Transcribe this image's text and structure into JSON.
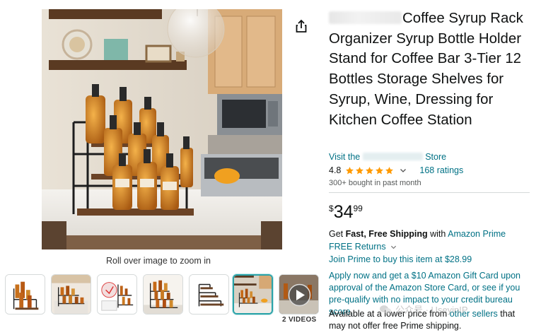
{
  "product": {
    "title_visible": "Coffee Syrup Rack Organizer Syrup Bottle Holder Stand for Coffee Bar 3-Tier 12 Bottles Storage Shelves for Syrup, Wine, Dressing for Kitchen Coffee Station",
    "store_link_prefix": "Visit the",
    "store_link_suffix": "Store"
  },
  "rating": {
    "value": "4.8",
    "stars": 4.8,
    "count_text": "168 ratings",
    "bought_text": "300+ bought in past month"
  },
  "price": {
    "symbol": "$",
    "whole": "34",
    "fraction": "99"
  },
  "shipping": {
    "prefix": "Get",
    "bold": "Fast, Free Shipping",
    "middle": "with",
    "prime_link": "Amazon Prime",
    "returns": "FREE Returns",
    "prime_buy": "Join Prime to buy this item at $28.99",
    "card_offer": "Apply now and get a $10 Amazon Gift Card upon approval of the Amazon Store Card, or see if you pre-qualify with no impact to your credit bureau score.",
    "availability_prefix": "Available at a lower price from",
    "availability_link": "other sellers",
    "availability_suffix": "that may not offer free Prime shipping."
  },
  "gallery": {
    "zoom_hint": "Roll over image to zoom in",
    "video_label": "2 VIDEOS",
    "selected_index": 5,
    "thumbnail_count": 6
  },
  "watermark": {
    "text": "公众号 · UseyinIP"
  },
  "colors": {
    "link": "#007185",
    "star": "#ff9a00",
    "selected_border": "#2aa3a9",
    "text": "#0f1111"
  },
  "icons": [
    "share-icon",
    "star-icon",
    "chevron-down-icon",
    "play-icon"
  ]
}
